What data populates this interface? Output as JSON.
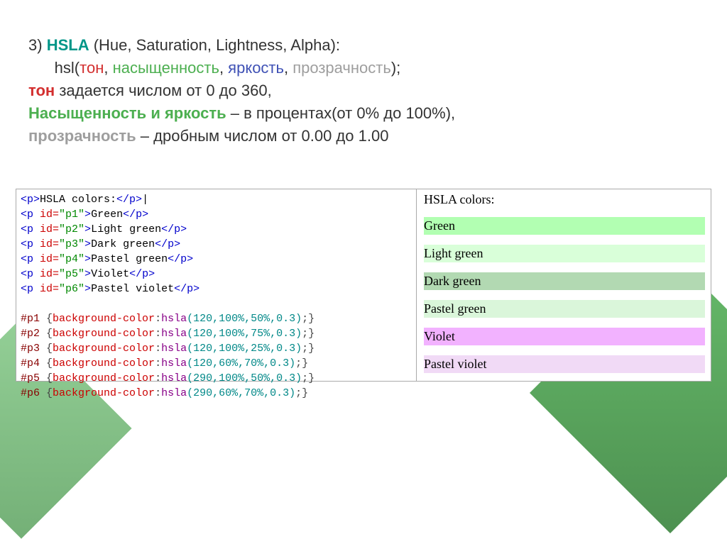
{
  "title": {
    "num": "3) ",
    "acr": "HSLA",
    "rest": " (Hue, Saturation, Lightness, Alpha):"
  },
  "line2": {
    "indent": "      hsl(",
    "tone": "тон",
    "c1": ", ",
    "sat": "насыщенность",
    "c2": ", ",
    "light": "яркость",
    "c3": ", ",
    "alpha": "прозрачность",
    "end": ");"
  },
  "line3": {
    "a": "тон",
    "b": " задается числом от 0 до 360,"
  },
  "line4": {
    "a": "Насыщенность и яркость",
    "b": " – в процентах(от 0% до 100%),"
  },
  "line5": {
    "a": "прозрачность",
    "b": " – дробным числом от 0.00 до 1.00"
  },
  "code": {
    "rows": [
      {
        "tag1": "<p>",
        "text": "HSLA colors:",
        "tag2": "</p>",
        "id": ""
      },
      {
        "tag1": "<p ",
        "attr": "id=",
        "val": "\"p1\"",
        "tag1b": ">",
        "text": "Green",
        "tag2": "</p>"
      },
      {
        "tag1": "<p ",
        "attr": "id=",
        "val": "\"p2\"",
        "tag1b": ">",
        "text": "Light green",
        "tag2": "</p>"
      },
      {
        "tag1": "<p ",
        "attr": "id=",
        "val": "\"p3\"",
        "tag1b": ">",
        "text": "Dark green",
        "tag2": "</p>"
      },
      {
        "tag1": "<p ",
        "attr": "id=",
        "val": "\"p4\"",
        "tag1b": ">",
        "text": "Pastel green",
        "tag2": "</p>"
      },
      {
        "tag1": "<p ",
        "attr": "id=",
        "val": "\"p5\"",
        "tag1b": ">",
        "text": "Violet",
        "tag2": "</p>"
      },
      {
        "tag1": "<p ",
        "attr": "id=",
        "val": "\"p6\"",
        "tag1b": ">",
        "text": "Pastel violet",
        "tag2": "</p>"
      }
    ],
    "css": [
      {
        "sel": "#p1",
        "brace": " {",
        "prop": "background-color",
        "colon": ":",
        "func": "hsla",
        "args": "(120,100%,50%,0.3)",
        "end": ";}"
      },
      {
        "sel": "#p2",
        "brace": " {",
        "prop": "background-color",
        "colon": ":",
        "func": "hsla",
        "args": "(120,100%,75%,0.3)",
        "end": ";}"
      },
      {
        "sel": "#p3",
        "brace": " {",
        "prop": "background-color",
        "colon": ":",
        "func": "hsla",
        "args": "(120,100%,25%,0.3)",
        "end": ";}"
      },
      {
        "sel": "#p4",
        "brace": " {",
        "prop": "background-color",
        "colon": ":",
        "func": "hsla",
        "args": "(120,60%,70%,0.3)",
        "end": ";}"
      },
      {
        "sel": "#p5",
        "brace": " {",
        "prop": "background-color",
        "colon": ":",
        "func": "hsla",
        "args": "(290,100%,50%,0.3)",
        "end": ";}"
      },
      {
        "sel": "#p6",
        "brace": " {",
        "prop": "background-color",
        "colon": ":",
        "func": "hsla",
        "args": "(290,60%,70%,0.3)",
        "end": ";}"
      }
    ]
  },
  "preview": {
    "title": "HSLA colors:",
    "items": [
      "Green",
      "Light green",
      "Dark green",
      "Pastel green",
      "Violet",
      "Pastel violet"
    ]
  }
}
